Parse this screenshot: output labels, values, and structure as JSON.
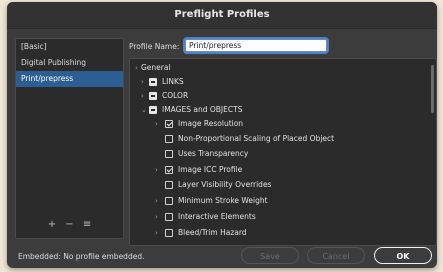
{
  "window": {
    "title": "Preflight Profiles"
  },
  "sidebar": {
    "items": [
      {
        "label": "[Basic]",
        "selected": false
      },
      {
        "label": "Digital Publishing",
        "selected": false
      },
      {
        "label": "Print/prepress",
        "selected": true
      }
    ],
    "tools": {
      "add": "+",
      "remove": "−",
      "menu": "≡"
    }
  },
  "profile": {
    "label": "Profile Name:",
    "value": "Print/prepress"
  },
  "tree": {
    "rows": [
      {
        "label": "General",
        "state": "none",
        "caret": "›"
      },
      {
        "label": "LINKS",
        "state": "mixed",
        "caret": "›"
      },
      {
        "label": "COLOR",
        "state": "mixed",
        "caret": "›"
      },
      {
        "label": "IMAGES and OBJECTS",
        "state": "mixed",
        "caret": "⌄"
      },
      {
        "label": "Image Resolution",
        "state": "checked",
        "caret": "›"
      },
      {
        "label": "Non-Proportional Scaling of Placed Object",
        "state": "unchecked",
        "caret": ""
      },
      {
        "label": "Uses Transparency",
        "state": "unchecked",
        "caret": ""
      },
      {
        "label": "Image ICC Profile",
        "state": "checked",
        "caret": "›"
      },
      {
        "label": "Layer Visibility Overrides",
        "state": "unchecked",
        "caret": ""
      },
      {
        "label": "Minimum Stroke Weight",
        "state": "unchecked",
        "caret": "›"
      },
      {
        "label": "Interactive Elements",
        "state": "unchecked",
        "caret": "›"
      },
      {
        "label": "Bleed/Trim Hazard",
        "state": "unchecked",
        "caret": "›"
      }
    ]
  },
  "footer": {
    "status": "Embedded: No profile embedded.",
    "save": "Save",
    "cancel": "Cancel",
    "ok": "OK"
  }
}
